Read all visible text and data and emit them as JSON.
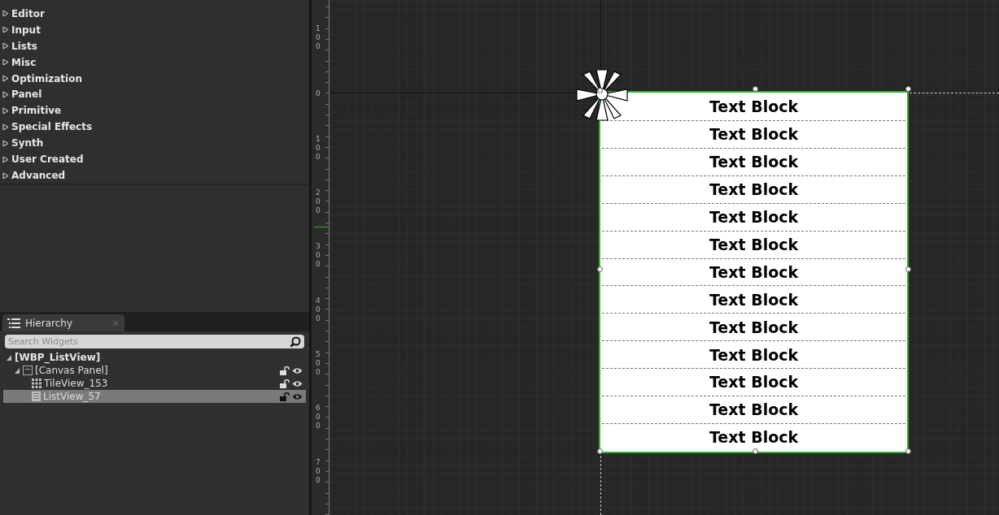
{
  "palette": {
    "categories": [
      {
        "label": "Editor",
        "expanded": false
      },
      {
        "label": "Input",
        "expanded": false
      },
      {
        "label": "Lists",
        "expanded": false
      },
      {
        "label": "Misc",
        "expanded": false
      },
      {
        "label": "Optimization",
        "expanded": false
      },
      {
        "label": "Panel",
        "expanded": false
      },
      {
        "label": "Primitive",
        "expanded": false
      },
      {
        "label": "Special Effects",
        "expanded": false
      },
      {
        "label": "Synth",
        "expanded": false
      },
      {
        "label": "User Created",
        "expanded": false
      },
      {
        "label": "Advanced",
        "expanded": false
      }
    ]
  },
  "hierarchy": {
    "tab": {
      "label": "Hierarchy",
      "close": "×"
    },
    "search": {
      "placeholder": "Search Widgets"
    },
    "tree": [
      {
        "label": "[WBP_ListView]",
        "kind": "root",
        "expanded": true,
        "selected": false,
        "children": [
          {
            "label": "[Canvas Panel]",
            "kind": "canvas",
            "expanded": true,
            "selected": false,
            "children": [
              {
                "label": "TileView_153",
                "kind": "tile",
                "selected": false
              },
              {
                "label": "ListView_57",
                "kind": "list",
                "selected": true
              }
            ]
          }
        ]
      }
    ]
  },
  "ruler": {
    "labels": [
      "100",
      "0",
      "100",
      "200",
      "300",
      "400",
      "500",
      "600",
      "700"
    ]
  },
  "designer": {
    "list_view": {
      "rows": [
        "Text Block",
        "Text Block",
        "Text Block",
        "Text Block",
        "Text Block",
        "Text Block",
        "Text Block",
        "Text Block",
        "Text Block",
        "Text Block",
        "Text Block",
        "Text Block",
        "Text Block"
      ],
      "selected": true
    }
  }
}
